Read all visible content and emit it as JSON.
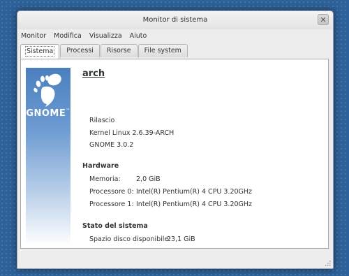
{
  "window": {
    "title": "Monitor di sistema"
  },
  "menu": [
    "Monitor",
    "Modifica",
    "Visualizza",
    "Aiuto"
  ],
  "tabs": [
    "Sistema",
    "Processi",
    "Risorse",
    "File system"
  ],
  "logo": {
    "text": "GNOME",
    "tm": "™"
  },
  "system": {
    "hostname": "arch",
    "release_label": "Rilascio",
    "kernel": "Kernel Linux 2.6.39-ARCH",
    "gnome": "GNOME 3.0.2"
  },
  "hardware": {
    "heading": "Hardware",
    "memory_label": "Memoria:",
    "memory_value": "2,0 GiB",
    "cpu0_label": "Processore 0:",
    "cpu0_value": "Intel(R) Pentium(R) 4 CPU 3.20GHz",
    "cpu1_label": "Processore 1:",
    "cpu1_value": "Intel(R) Pentium(R) 4 CPU 3.20GHz"
  },
  "status": {
    "heading": "Stato del sistema",
    "disk_label": "Spazio disco disponibile:",
    "disk_value": "23,1 GiB"
  },
  "colors": {
    "desktop": "#2d6199",
    "logo_top": "#4a7fbf",
    "panel": "#ffffff"
  },
  "icons": {
    "close": "close-icon",
    "logo": "gnome-foot-icon",
    "grip": "resize-grip-icon"
  }
}
